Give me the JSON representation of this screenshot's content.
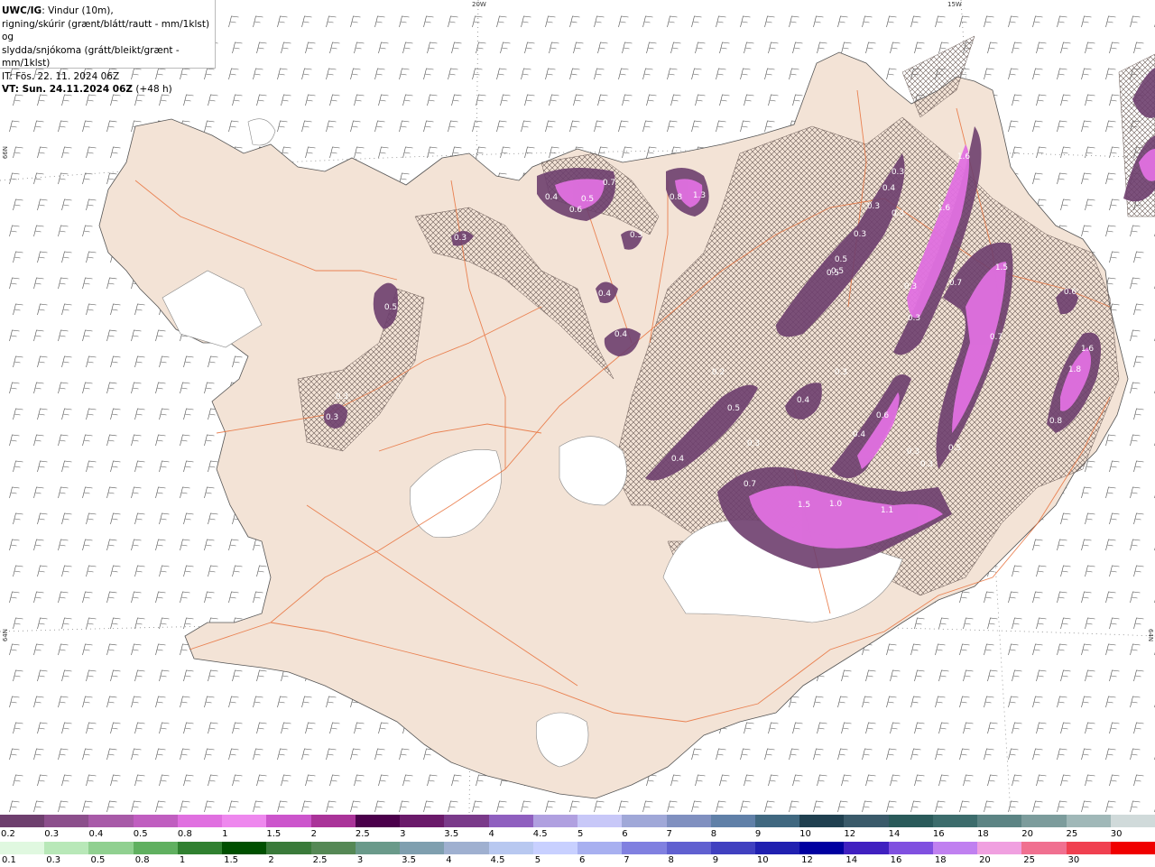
{
  "header": {
    "product": "UWC/IG",
    "line1_rest": ": Vindur (10m),",
    "line2": "rigning/skúrir (grænt/blátt/rautt - mm/1klst) og",
    "line3": "slydda/snjókoma (grátt/bleikt/grænt - mm/1klst)",
    "line4": "IT: Fös. 22. 11. 2024 06Z",
    "line5_bold": "VT: Sun. 24.11.2024 06Z",
    "line5_rest": " (+48 h)"
  },
  "grid_labels": {
    "top_20w": "20W",
    "top_15w": "15W",
    "left_66n": "66N",
    "left_64n": "64N",
    "right_64n": "64N"
  },
  "snow_labels": [
    "0.3",
    "0.4",
    "0.5",
    "0.6",
    "0.7",
    "0.8",
    "1.3",
    "0.3",
    "0.4",
    "0.4",
    "0.5",
    "0.3",
    "0.3",
    "0.3",
    "0.4",
    "0.3",
    "0.3",
    "1.6",
    "1.6",
    "0.3",
    "0.5",
    "0.5",
    "0.5",
    "1.5",
    "0.7",
    "0.7",
    "0.6",
    "1.6",
    "1.8",
    "0.8",
    "0.2",
    "0.3",
    "0.4",
    "0.5",
    "0.3",
    "0.4",
    "0.6",
    "0.4",
    "0.3",
    "0.5",
    "0.3",
    "0.7",
    "1.5",
    "1.0",
    "1.1",
    "0.3",
    "0.3"
  ],
  "legend_snow": {
    "colors": [
      "#6e3f6e",
      "#8c4f8c",
      "#a85aa8",
      "#c05ec0",
      "#e070e0",
      "#ee88ee",
      "#cc55cc",
      "#aa3399",
      "#4b004b",
      "#6a1a6a",
      "#7a3a8a",
      "#8f5fbf",
      "#b0a0e0",
      "#c8c8f8",
      "#a0a8d8",
      "#8090c0",
      "#6080a8",
      "#406880",
      "#204050",
      "#3a5a6a",
      "#2a5a5a",
      "#3c6c6c",
      "#5c8484",
      "#7c9c9c",
      "#a0b8b8",
      "#d0dada"
    ],
    "labels": [
      "0.2",
      "0.3",
      "0.4",
      "0.5",
      "0.8",
      "1",
      "1.5",
      "2",
      "2.5",
      "3",
      "3.5",
      "4",
      "4.5",
      "5",
      "6",
      "7",
      "8",
      "9",
      "10",
      "12",
      "14",
      "16",
      "18",
      "20",
      "25",
      "30"
    ]
  },
  "legend_rain": {
    "colors": [
      "#e0f8e0",
      "#b8e8b8",
      "#90d090",
      "#60b060",
      "#308030",
      "#005000",
      "#3a7a3a",
      "#558855",
      "#6a9a8a",
      "#7f9faf",
      "#9fb0d0",
      "#b8c8f0",
      "#c8d0ff",
      "#a8b0f0",
      "#8080e0",
      "#6060d0",
      "#4040c0",
      "#2020b0",
      "#0000a0",
      "#4020c0",
      "#8050e0",
      "#c080f0",
      "#f0a0e0",
      "#f07090",
      "#f04050",
      "#f00000"
    ],
    "labels": [
      "0.1",
      "0.3",
      "0.5",
      "0.8",
      "1",
      "1.5",
      "2",
      "2.5",
      "3",
      "3.5",
      "4",
      "4.5",
      "5",
      "6",
      "7",
      "8",
      "9",
      "10",
      "12",
      "14",
      "16",
      "18",
      "20",
      "25",
      "30"
    ]
  }
}
